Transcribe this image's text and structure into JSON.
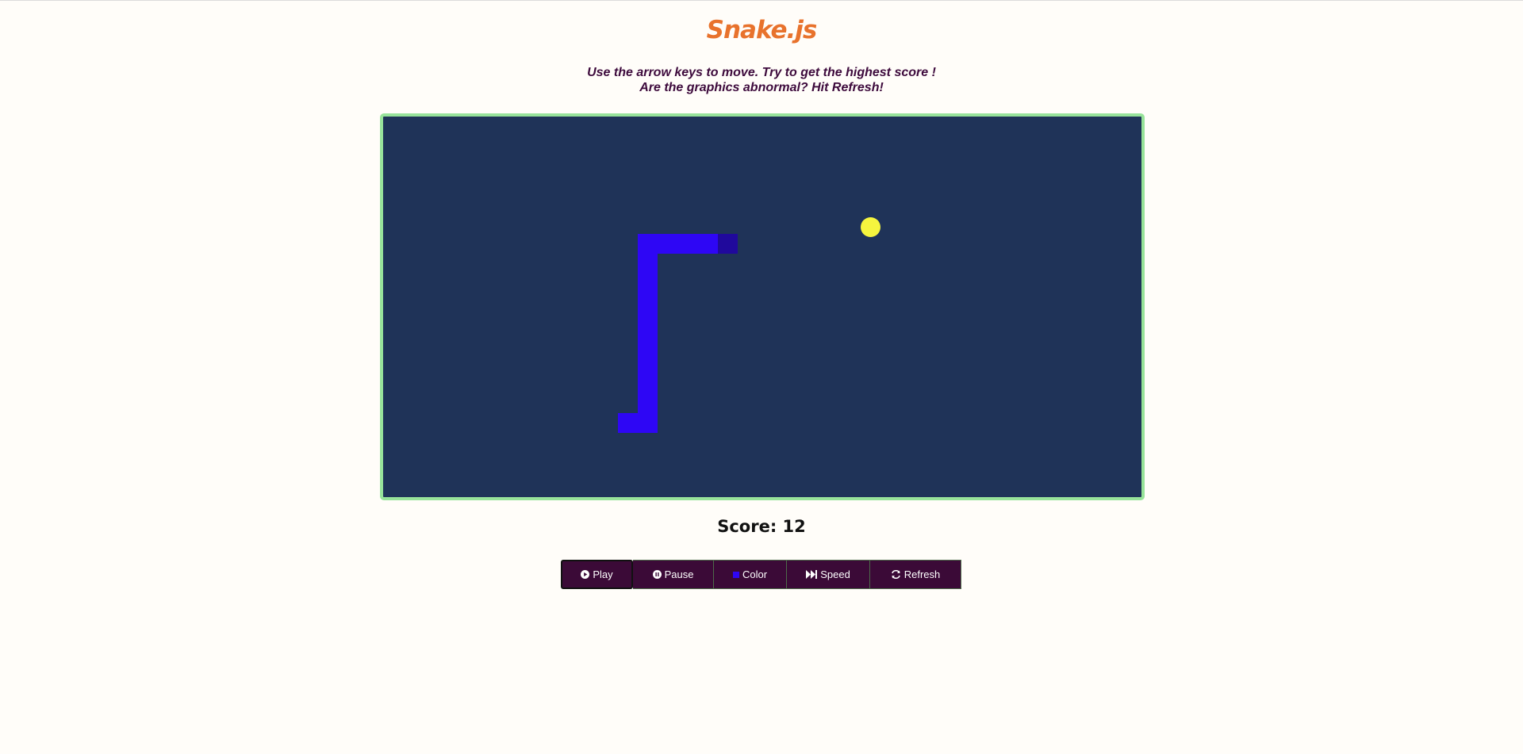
{
  "title": "Snake.js",
  "instructions": {
    "line1": "Use the arrow keys to move. Try to get the highest score !",
    "line2": "Are the graphics abnormal? Hit Refresh!"
  },
  "game": {
    "snake_color": "#2e06f5",
    "snake_head_color": "#20099c",
    "food_color": "#f5f53e",
    "board_color": "#1f3358",
    "board_border_color": "#97e39a"
  },
  "score": {
    "label": "Score:",
    "value": "12"
  },
  "controls": {
    "play": {
      "label": "Play",
      "icon": "play-circle-icon"
    },
    "pause": {
      "label": "Pause",
      "icon": "pause-circle-icon"
    },
    "color": {
      "label": "Color",
      "icon": "color-swatch-icon"
    },
    "speed": {
      "label": "Speed",
      "icon": "fast-forward-icon"
    },
    "refresh": {
      "label": "Refresh",
      "icon": "refresh-icon"
    }
  }
}
